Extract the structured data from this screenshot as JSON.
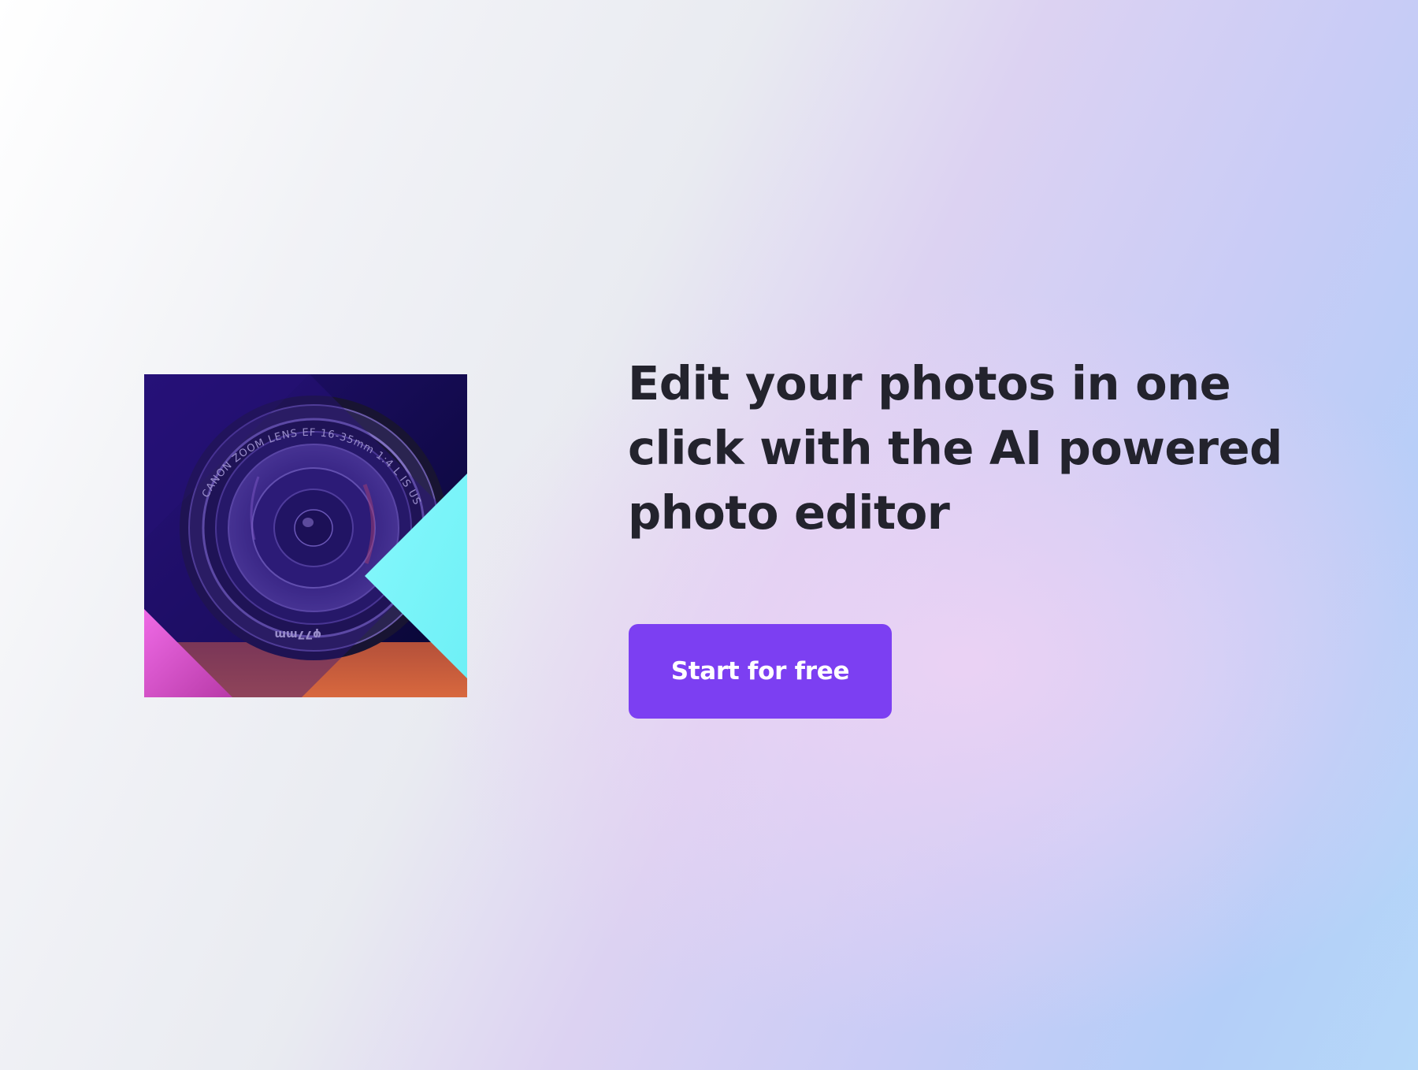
{
  "hero": {
    "headline": "Edit your photos in one click with the AI powered photo editor",
    "cta_label": "Start for free",
    "image_alt": "camera-lens-photo",
    "lens_ring_text": "CANON ZOOM LENS EF 16-35mm 1:4 L IS USM",
    "lens_filter_text": "φ77mm"
  },
  "colors": {
    "headline": "#23232d",
    "cta_background": "#7c3ff2",
    "cta_text": "#ffffff",
    "image_overlay": "#2a1280",
    "cyan_accent": "#7ef6fb",
    "pink_accent": "#e85ee0"
  }
}
